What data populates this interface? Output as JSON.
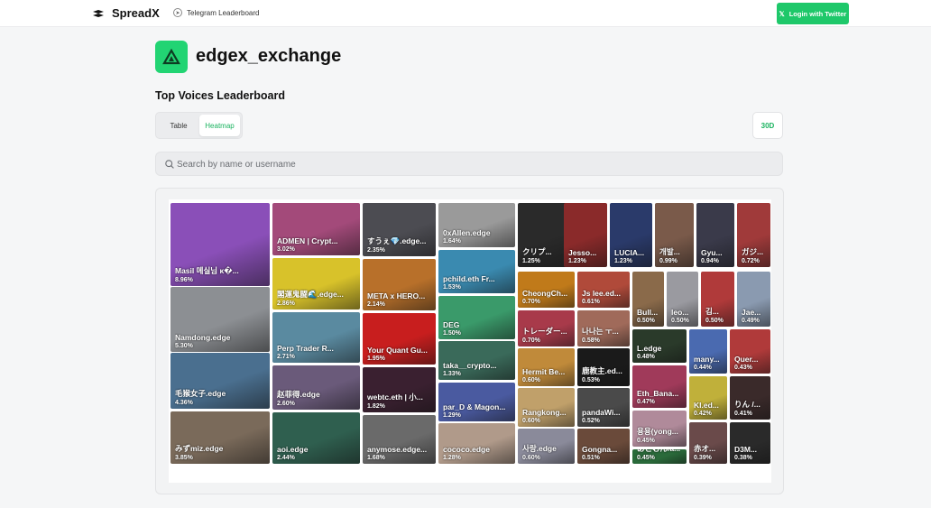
{
  "header": {
    "brand": "SpreadX",
    "telegram_link": "Telegram Leaderboard",
    "login_button": "Login with Twitter"
  },
  "exchange": {
    "name": "edgex_exchange"
  },
  "leaderboard": {
    "title": "Top Voices Leaderboard",
    "tabs": [
      "Table",
      "Heatmap"
    ],
    "active_tab": "Heatmap",
    "period": "30D"
  },
  "search": {
    "placeholder": "Search by name or username",
    "value": ""
  },
  "colors": {
    "accent": "#1ec86a",
    "accent_text": "#1ab35f"
  },
  "heatmap": [
    {
      "name": "Masil 메실님 κ�...",
      "pct": "8.96%",
      "color": "#8a4fb8"
    },
    {
      "name": "Namdong.edge",
      "pct": "5.30%",
      "color": "#8c8f93"
    },
    {
      "name": "毛猴女子.edge",
      "pct": "4.36%",
      "color": "#4a6f8f"
    },
    {
      "name": "みずmiz.edge",
      "pct": "3.85%",
      "color": "#7a6a5a"
    },
    {
      "name": "ADMEN | Crypt...",
      "pct": "3.02%",
      "color": "#a34a7a"
    },
    {
      "name": "閣運鬼闘🌊.edge...",
      "pct": "2.86%",
      "color": "#d8c22a"
    },
    {
      "name": "Perp Trader R...",
      "pct": "2.71%",
      "color": "#5a8aa0"
    },
    {
      "name": "赵菲得.edge",
      "pct": "2.60%",
      "color": "#6a5a7a"
    },
    {
      "name": "aoi.edge",
      "pct": "2.44%",
      "color": "#2f5f4f"
    },
    {
      "name": "すうぇ💎.edge...",
      "pct": "2.35%",
      "color": "#4c4c52"
    },
    {
      "name": "META x HERO...",
      "pct": "2.14%",
      "color": "#b8702a"
    },
    {
      "name": "Your Quant Gu...",
      "pct": "1.95%",
      "color": "#c81e1e"
    },
    {
      "name": "webtc.eth | 小...",
      "pct": "1.82%",
      "color": "#3a2030"
    },
    {
      "name": "anymose.edge...",
      "pct": "1.68%",
      "color": "#6a6a6a"
    },
    {
      "name": "0xAllen.edge",
      "pct": "1.64%",
      "color": "#9a9a9a"
    },
    {
      "name": "pchild.eth Fr...",
      "pct": "1.53%",
      "color": "#3a8ab0"
    },
    {
      "name": "DEG",
      "pct": "1.50%",
      "color": "#3a9a6a"
    },
    {
      "name": "taka__crypto...",
      "pct": "1.33%",
      "color": "#3a6a5a"
    },
    {
      "name": "par_D & Magon...",
      "pct": "1.29%",
      "color": "#4a5aa0"
    },
    {
      "name": "cococo.edge",
      "pct": "1.28%",
      "color": "#b09a8a"
    },
    {
      "name": "クリプ...",
      "pct": "1.25%",
      "color": "#2a2a2a"
    },
    {
      "name": "Jesso...",
      "pct": "1.23%",
      "color": "#8a2a2a"
    },
    {
      "name": "LUCIA...",
      "pct": "1.23%",
      "color": "#2a3a6a"
    },
    {
      "name": "개발...",
      "pct": "0.99%",
      "color": "#7a5a4a"
    },
    {
      "name": "Gyu...",
      "pct": "0.94%",
      "color": "#3a3a4a"
    },
    {
      "name": "ガジ...",
      "pct": "0.72%",
      "color": "#a03a3a"
    },
    {
      "name": "CheongCh...",
      "pct": "0.70%",
      "color": "#c07a1a"
    },
    {
      "name": "Js lee.ed...",
      "pct": "0.61%",
      "color": "#b04a3a"
    },
    {
      "name": "Bull...",
      "pct": "0.50%",
      "color": "#8a6a4a"
    },
    {
      "name": "leo...",
      "pct": "0.50%",
      "color": "#9a9aa0"
    },
    {
      "name": "김...",
      "pct": "0.50%",
      "color": "#b03a3a"
    },
    {
      "name": "Jae...",
      "pct": "0.49%",
      "color": "#8a9ab0"
    },
    {
      "name": "トレーダー...",
      "pct": "0.70%",
      "color": "#a83a4a"
    },
    {
      "name": "나나는 ㅜ...",
      "pct": "0.58%",
      "color": "#a06a5a"
    },
    {
      "name": "L.edge",
      "pct": "0.48%",
      "color": "#2a3a2a"
    },
    {
      "name": "many...",
      "pct": "0.44%",
      "color": "#4a6ab0"
    },
    {
      "name": "Quer...",
      "pct": "0.43%",
      "color": "#b03a3a"
    },
    {
      "name": "Hermit Be...",
      "pct": "0.60%",
      "color": "#c08a3a"
    },
    {
      "name": "鹿教主.ed...",
      "pct": "0.53%",
      "color": "#1a1a1a"
    },
    {
      "name": "Eth_Bana...",
      "pct": "0.47%",
      "color": "#a03a5a"
    },
    {
      "name": "Kl.ed...",
      "pct": "0.42%",
      "color": "#c0b03a"
    },
    {
      "name": "りん /...",
      "pct": "0.41%",
      "color": "#3a2a2a"
    },
    {
      "name": "Rangkong...",
      "pct": "0.60%",
      "color": "#c0a06a"
    },
    {
      "name": "pandaWi...",
      "pct": "0.52%",
      "color": "#4a4a4a"
    },
    {
      "name": "용용(yong...",
      "pct": "0.45%",
      "color": "#b08a9a"
    },
    {
      "name": "사랑.edge",
      "pct": "0.60%",
      "color": "#8a8a9a"
    },
    {
      "name": "Gongna...",
      "pct": "0.51%",
      "color": "#6a4a3a"
    },
    {
      "name": "あとむん/a...",
      "pct": "0.45%",
      "color": "#2a6a3a"
    },
    {
      "name": "赤オ...",
      "pct": "0.39%",
      "color": "#6a4a4a"
    },
    {
      "name": "D3M...",
      "pct": "0.38%",
      "color": "#2a2a2a"
    }
  ]
}
